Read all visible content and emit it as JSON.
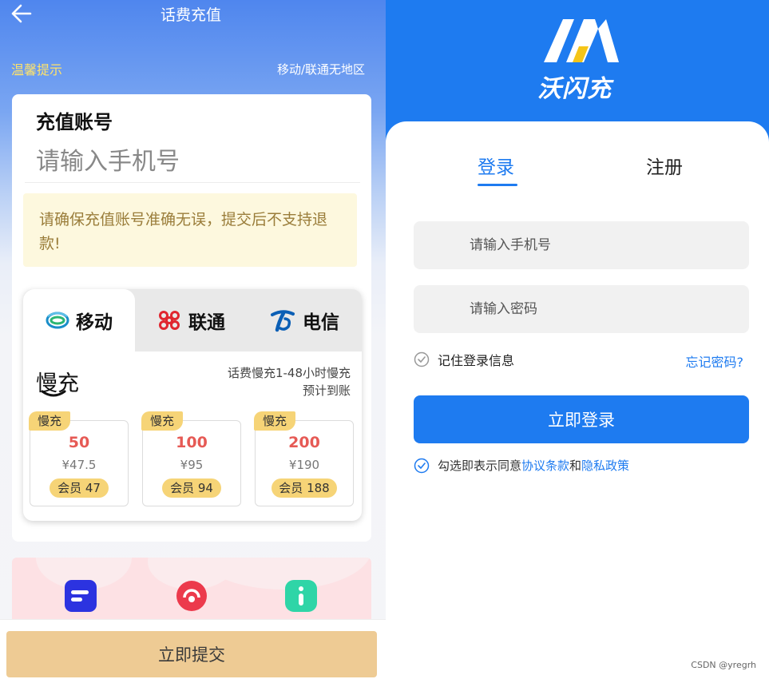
{
  "left": {
    "title": "话费充值",
    "tips_label": "温馨提示",
    "tips_right": "移动/联通无地区",
    "account": {
      "title": "充值账号",
      "placeholder": "请输入手机号"
    },
    "warning": "请确保充值账号准确无误，提交后不支持退款!",
    "operators": [
      {
        "label": "移动",
        "icon": "china-mobile-icon",
        "active": true
      },
      {
        "label": "联通",
        "icon": "china-unicom-icon",
        "active": false
      },
      {
        "label": "电信",
        "icon": "china-telecom-icon",
        "active": false
      }
    ],
    "slow": {
      "label": "慢充",
      "desc_line1": "话费慢充1-48小时慢充",
      "desc_line2": "预计到账"
    },
    "packages": [
      {
        "tag": "慢充",
        "amount": "50",
        "price": "¥47.5",
        "member": "会员 47"
      },
      {
        "tag": "慢充",
        "amount": "100",
        "price": "¥95",
        "member": "会员 94"
      },
      {
        "tag": "慢充",
        "amount": "200",
        "price": "¥190",
        "member": "会员 188"
      }
    ],
    "promo_icons": [
      "menu-icon",
      "headset-icon",
      "info-icon"
    ],
    "submit_label": "立即提交",
    "colors": {
      "accent_gold": "#eecb94",
      "price_red": "#e65a55",
      "tag_yellow": "#f6d477"
    }
  },
  "right": {
    "logo_text": "沃闪充",
    "tabs": {
      "login": "登录",
      "register": "注册"
    },
    "phone_placeholder": "请输入手机号",
    "password_placeholder": "请输入密码",
    "remember_label": "记住登录信息",
    "forgot_label": "忘记密码?",
    "login_button": "立即登录",
    "agree": {
      "prefix": "勾选即表示同意",
      "terms": "协议条款",
      "and": "和",
      "privacy": "隐私政策"
    },
    "colors": {
      "brand_blue": "#1e7bf0"
    }
  },
  "watermark": "CSDN @yregrh"
}
